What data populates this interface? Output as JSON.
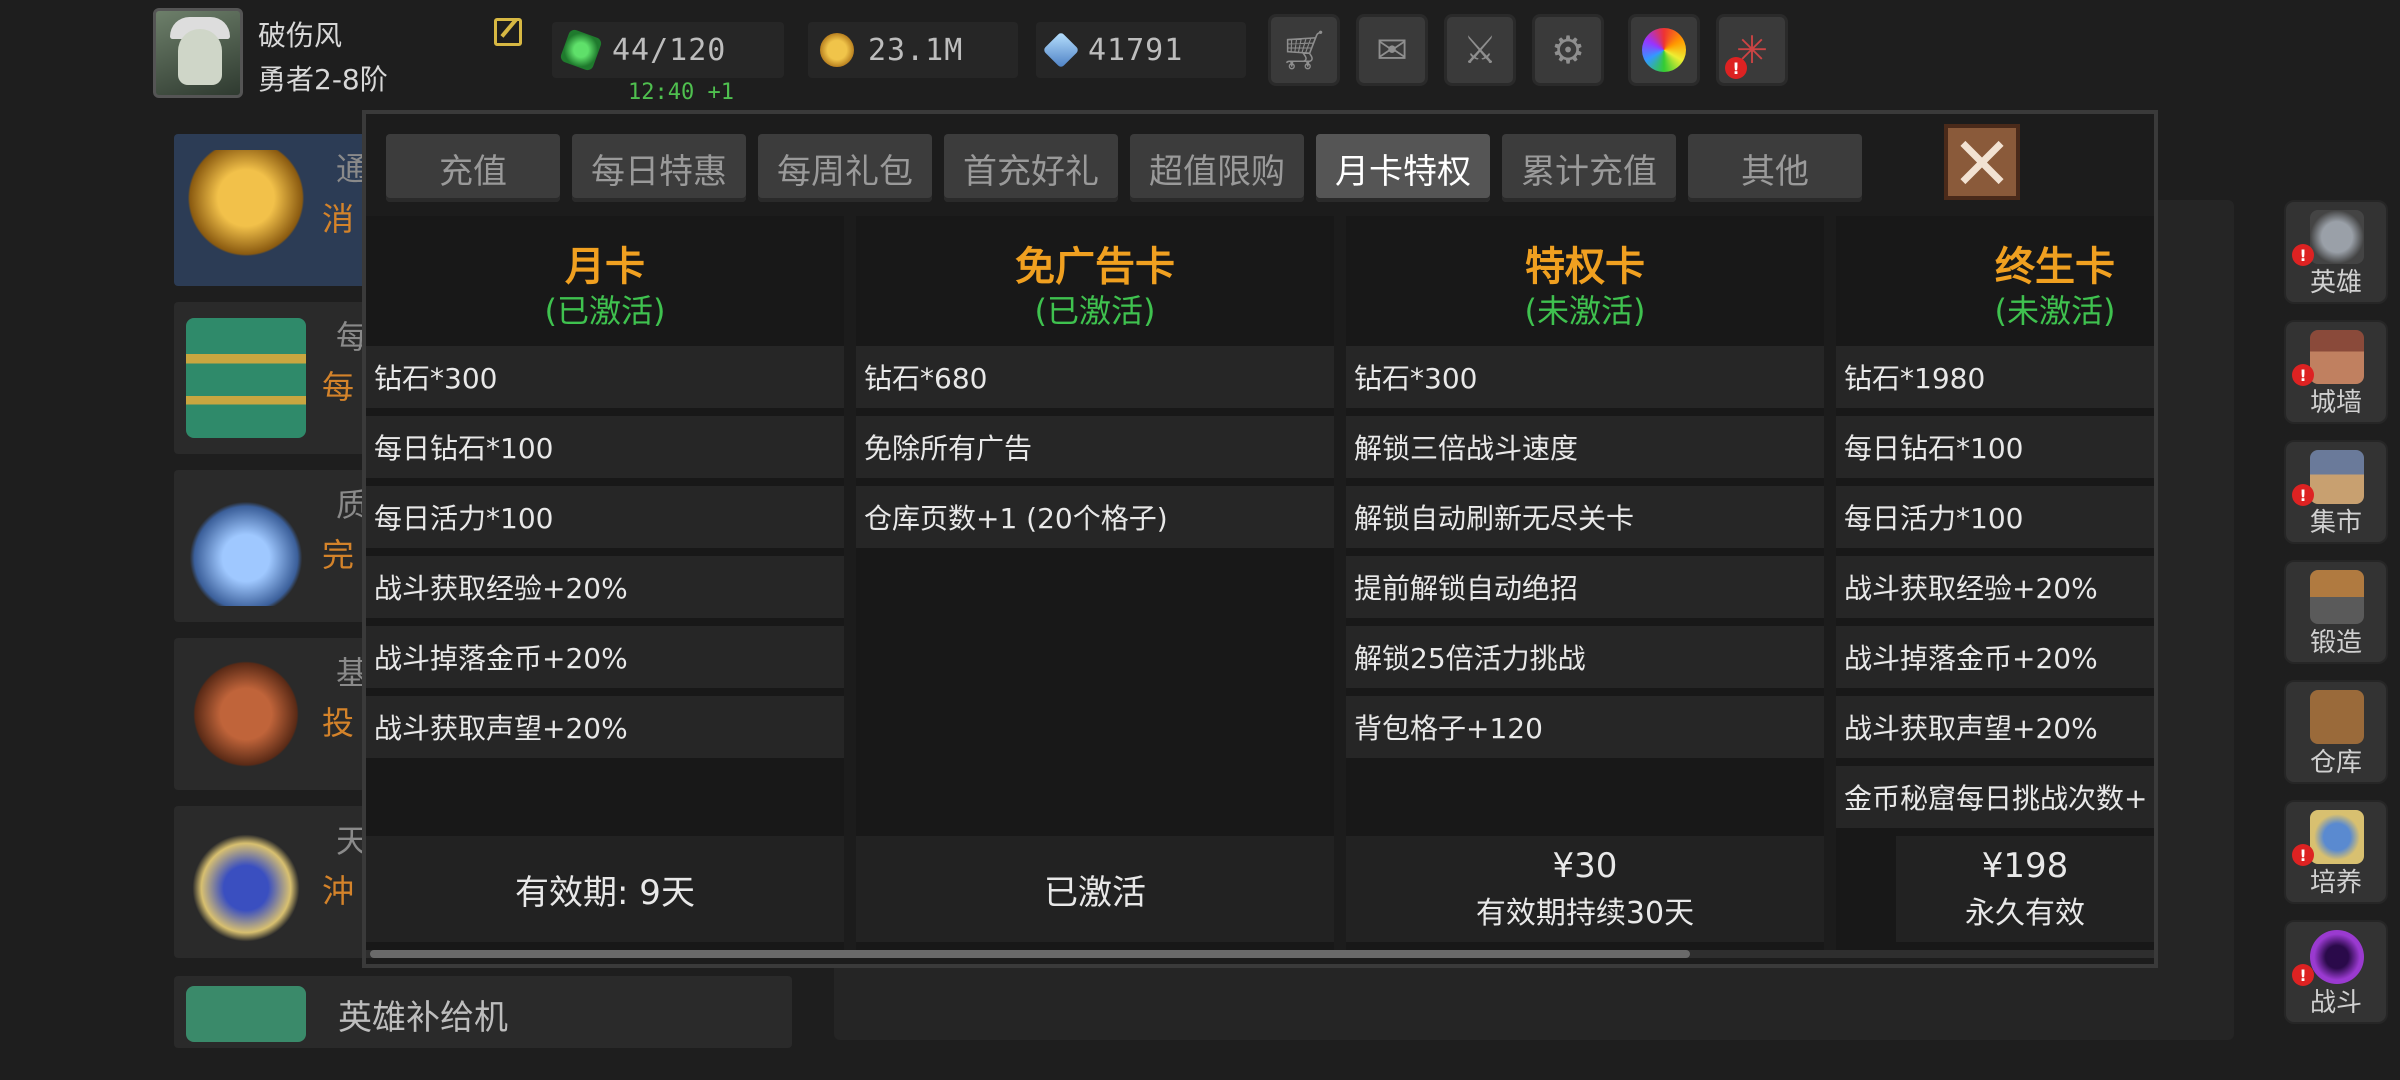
{
  "player": {
    "name": "破伤风",
    "rank": "勇者2-8阶"
  },
  "resources": {
    "stamina": "44/120",
    "stamina_timer": "12:40 +1",
    "gold": "23.1M",
    "gems": "41791"
  },
  "top_icons": [
    "shopping-cart",
    "mail",
    "gamepad",
    "gear",
    "color-wheel",
    "firework"
  ],
  "background_list": {
    "items": [
      {
        "char_a": "通",
        "char_b": "消"
      },
      {
        "char_a": "每",
        "char_b": "每"
      },
      {
        "char_a": "质",
        "char_b": "完"
      },
      {
        "char_a": "基",
        "char_b": "投"
      },
      {
        "char_a": "天",
        "char_b": "沖"
      }
    ],
    "supply_label": "英雄补给机"
  },
  "side_menu": [
    {
      "label": "英雄"
    },
    {
      "label": "城墙"
    },
    {
      "label": "集市"
    },
    {
      "label": "锻造"
    },
    {
      "label": "仓库"
    },
    {
      "label": "培养"
    },
    {
      "label": "战斗"
    }
  ],
  "tabs": [
    {
      "label": "充值"
    },
    {
      "label": "每日特惠"
    },
    {
      "label": "每周礼包"
    },
    {
      "label": "首充好礼"
    },
    {
      "label": "超值限购"
    },
    {
      "label": "月卡特权"
    },
    {
      "label": "累计充值"
    },
    {
      "label": "其他"
    }
  ],
  "active_tab": "月卡特权",
  "cards": [
    {
      "title": "月卡",
      "status": "(已激活)",
      "perks": [
        "钻石*300",
        "每日钻石*100",
        "每日活力*100",
        "战斗获取经验+20%",
        "战斗掉落金币+20%",
        "战斗获取声望+20%"
      ],
      "footer_main": "有效期: 9天",
      "footer_sub": ""
    },
    {
      "title": "免广告卡",
      "status": "(已激活)",
      "perks": [
        "钻石*680",
        "免除所有广告",
        "仓库页数+1 (20个格子)"
      ],
      "footer_main": "已激活",
      "footer_sub": ""
    },
    {
      "title": "特权卡",
      "status": "(未激活)",
      "perks": [
        "钻石*300",
        "解锁三倍战斗速度",
        "解锁自动刷新无尽关卡",
        "提前解锁自动绝招",
        "解锁25倍活力挑战",
        "背包格子+120"
      ],
      "footer_main": "¥30",
      "footer_sub": "有效期持续30天"
    },
    {
      "title": "终生卡",
      "status": "(未激活)",
      "perks": [
        "钻石*1980",
        "每日钻石*100",
        "每日活力*100",
        "战斗获取经验+20%",
        "战斗掉落金币+20%",
        "战斗获取声望+20%",
        "金币秘窟每日挑战次数+"
      ],
      "footer_main": "¥198",
      "footer_sub": "永久有效"
    }
  ],
  "colors": {
    "title_gold": "#f0a020",
    "status_green": "#3fc24f",
    "timer_green": "#4fc04f",
    "badge_red": "#dd2222"
  }
}
